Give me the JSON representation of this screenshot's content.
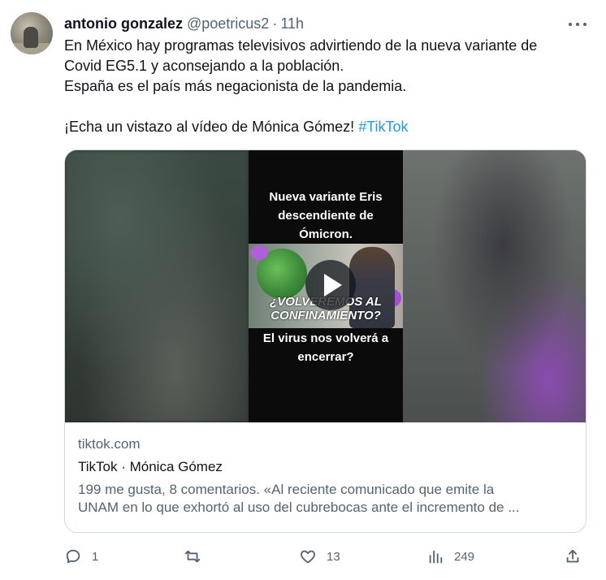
{
  "tweet": {
    "author_name": "antonio gonzalez",
    "handle": "@poetricus2",
    "separator": "·",
    "time": "11h",
    "text_lines": [
      "En México hay programas televisivos advirtiendo de la nueva variante de",
      "Covid EG5.1 y  aconsejando a la población.",
      "España es el país más negacionista de la pandemia."
    ],
    "text_cta": "¡Echa un vistazo al vídeo de Mónica Gómez! ",
    "hashtag": "#TikTok"
  },
  "card": {
    "video_top_lines": [
      "Nueva variante Eris",
      "descendiente de",
      "Ómicron."
    ],
    "video_caption_lines": [
      "¿VOLVEREMOS AL",
      "CONFINAMIENTO?"
    ],
    "video_bottom_lines": [
      "El virus nos volverá a",
      "encerrar?"
    ],
    "domain": "tiktok.com",
    "title": "TikTok · Mónica Gómez",
    "description_lines": [
      "199 me gusta, 8 comentarios. «Al reciente comunicado que emite la",
      "UNAM en lo que exhortó al uso del cubrebocas ante el incremento de ..."
    ]
  },
  "actions": {
    "replies": "1",
    "retweets": "",
    "likes": "13",
    "views": "249"
  },
  "colors": {
    "accent": "#1d9bf0",
    "secondary_text": "#536471",
    "primary_text": "#0f1419",
    "border": "#cfd9de"
  },
  "icons": [
    "more-icon",
    "reply-icon",
    "retweet-icon",
    "like-icon",
    "views-icon",
    "share-icon",
    "play-icon"
  ]
}
